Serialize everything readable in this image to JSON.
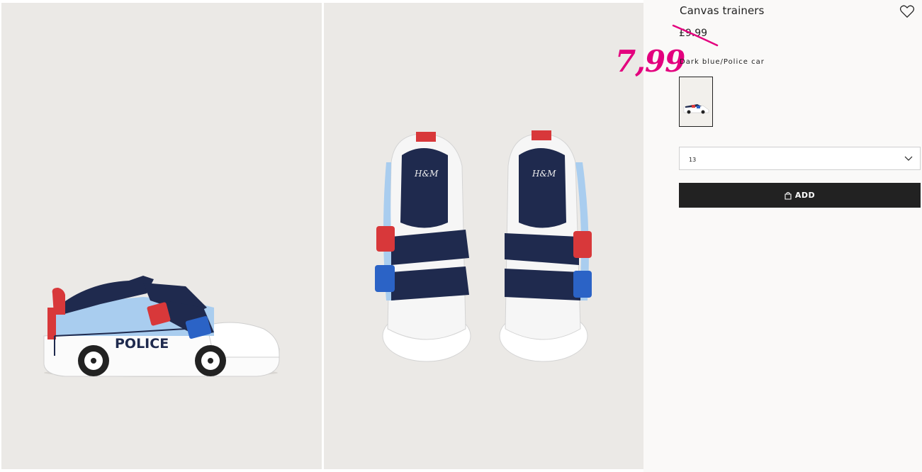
{
  "product": {
    "title": "Canvas trainers",
    "old_price": "£9.99",
    "new_price": "7,99",
    "color_name": "Dark blue/Police car",
    "size": "13",
    "add_label": "ADD",
    "shoe_text": "POLICE",
    "brand_mark": "H&M"
  },
  "icons": {
    "favorite": "heart-outline-icon",
    "size_dropdown": "chevron-down-icon",
    "add_button": "shopping-bag-icon"
  },
  "colors": {
    "sale_price": "#e3007e",
    "button_bg": "#222222",
    "photo_bg": "#ebe9e6",
    "shoe_navy": "#1f2a4e",
    "shoe_light_blue": "#a9cdef",
    "shoe_red": "#d8383a",
    "shoe_blue": "#2b63c6"
  }
}
